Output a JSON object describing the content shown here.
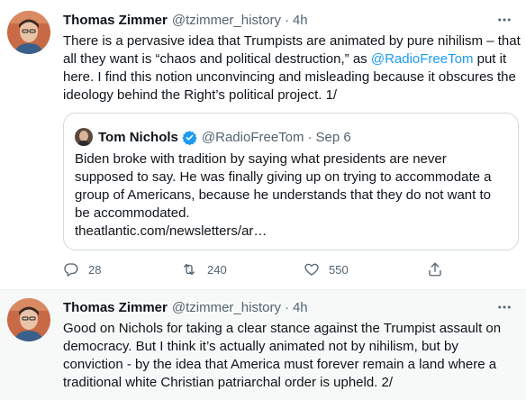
{
  "tweets": [
    {
      "author_name": "Thomas Zimmer",
      "handle": "@tzimmer_history",
      "separator": "·",
      "time": "4h",
      "text_lines": [
        "There is a pervasive idea that Trumpists are animated by pure nihilism – that",
        "all they want is “chaos and political destruction,” as ",
        "@RadioFreeTom",
        " put it",
        "here. I find this notion unconvincing and misleading because it obscures the",
        "ideology behind the Right’s political project. 1/"
      ],
      "quote": {
        "author_name": "Tom Nichols",
        "handle": "@RadioFreeTom",
        "separator": "·",
        "date": "Sep 6",
        "text_lines": [
          "Biden broke with tradition by saying what presidents are never",
          "supposed to say. He was finally giving up on trying to accommodate a",
          "group of Americans, because he understands that they do not want to",
          "be accommodated."
        ],
        "link": "theatlantic.com/newsletters/ar…"
      },
      "actions": {
        "replies": "28",
        "retweets": "240",
        "likes": "550"
      }
    },
    {
      "author_name": "Thomas Zimmer",
      "handle": "@tzimmer_history",
      "separator": "·",
      "time": "4h",
      "text_lines": [
        "Good on Nichols for taking a clear stance against the Trumpist assault on",
        "democracy. But I think it’s actually animated not by nihilism, but by",
        "conviction - by the idea that America must forever remain a land where a",
        "traditional white Christian patriarchal order is upheld. 2/"
      ]
    }
  ],
  "icons": {
    "more": "more-horizontal-icon",
    "reply": "reply-icon",
    "retweet": "retweet-icon",
    "like": "heart-icon",
    "share": "share-icon",
    "verified": "verified-badge-icon"
  },
  "colors": {
    "accent": "#1d9bf0",
    "secondary_text": "#536471",
    "border": "#cfd9de",
    "thread_bg": "#f7f9f9"
  }
}
